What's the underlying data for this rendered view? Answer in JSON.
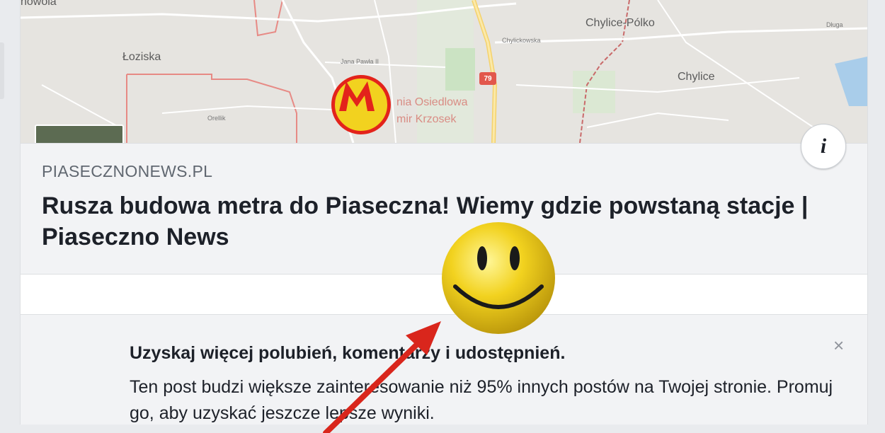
{
  "map": {
    "labels": {
      "lozniska": "Łoziska",
      "nowola": "nowola",
      "chylice_polko": "Chylice-Pólko",
      "chylice": "Chylice",
      "apteka": "nia Osiedlowa",
      "krzosek": "mir Krzosek",
      "jana_pawla": "Jana Pawła II",
      "road": "79",
      "chylicka": "Chylickowska",
      "drugs": "Długa",
      "orellik": "Orellik"
    }
  },
  "link_preview": {
    "domain": "PIASECZNONEWS.PL",
    "headline": "Rusza budowa metra do Piaseczna! Wiemy gdzie powstaną stacje | Piaseczno News"
  },
  "info_button": {
    "label": "i"
  },
  "promo": {
    "title": "Uzyskaj więcej polubień, komentarzy i udostępnień.",
    "body": "Ten post budzi większe zainteresowanie niż 95% innych postów na Twojej stronie. Promuj go, aby uzyskać jeszcze lepsze wyniki.",
    "close": "×"
  },
  "colors": {
    "arrow": "#d9261c",
    "smiley_face": "#f2d21f",
    "metro_ring": "#e3231b"
  }
}
